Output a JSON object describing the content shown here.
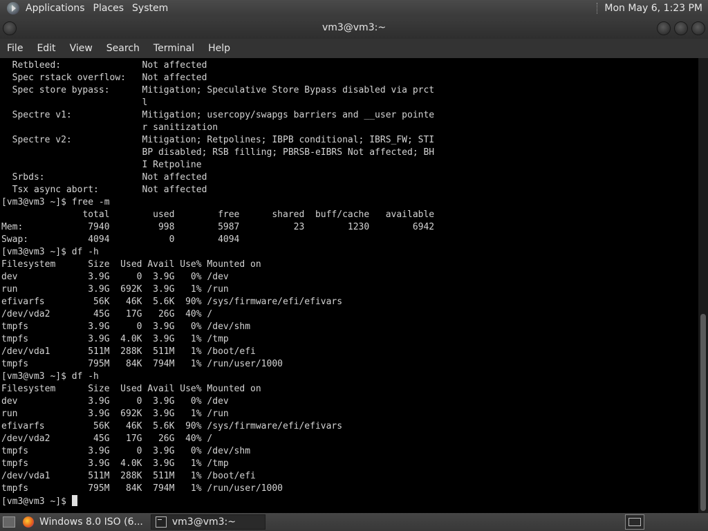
{
  "top_panel": {
    "menus": [
      "Applications",
      "Places",
      "System"
    ],
    "clock": "Mon May  6,  1:23 PM"
  },
  "window": {
    "title": "vm3@vm3:~"
  },
  "menubar": {
    "items": [
      "File",
      "Edit",
      "View",
      "Search",
      "Terminal",
      "Help"
    ]
  },
  "terminal": {
    "lines": [
      "  Retbleed:               Not affected",
      "  Spec rstack overflow:   Not affected",
      "  Spec store bypass:      Mitigation; Speculative Store Bypass disabled via prct",
      "                          l",
      "  Spectre v1:             Mitigation; usercopy/swapgs barriers and __user pointe",
      "                          r sanitization",
      "  Spectre v2:             Mitigation; Retpolines; IBPB conditional; IBRS_FW; STI",
      "                          BP disabled; RSB filling; PBRSB-eIBRS Not affected; BH",
      "                          I Retpoline",
      "  Srbds:                  Not affected",
      "  Tsx async abort:        Not affected",
      "[vm3@vm3 ~]$ free -m",
      "               total        used        free      shared  buff/cache   available",
      "Mem:            7940         998        5987          23        1230        6942",
      "Swap:           4094           0        4094",
      "[vm3@vm3 ~]$ df -h",
      "Filesystem      Size  Used Avail Use% Mounted on",
      "dev             3.9G     0  3.9G   0% /dev",
      "run             3.9G  692K  3.9G   1% /run",
      "efivarfs         56K   46K  5.6K  90% /sys/firmware/efi/efivars",
      "/dev/vda2        45G   17G   26G  40% /",
      "tmpfs           3.9G     0  3.9G   0% /dev/shm",
      "tmpfs           3.9G  4.0K  3.9G   1% /tmp",
      "/dev/vda1       511M  288K  511M   1% /boot/efi",
      "tmpfs           795M   84K  794M   1% /run/user/1000",
      "[vm3@vm3 ~]$ df -h",
      "Filesystem      Size  Used Avail Use% Mounted on",
      "dev             3.9G     0  3.9G   0% /dev",
      "run             3.9G  692K  3.9G   1% /run",
      "efivarfs         56K   46K  5.6K  90% /sys/firmware/efi/efivars",
      "/dev/vda2        45G   17G   26G  40% /",
      "tmpfs           3.9G     0  3.9G   0% /dev/shm",
      "tmpfs           3.9G  4.0K  3.9G   1% /tmp",
      "/dev/vda1       511M  288K  511M   1% /boot/efi",
      "tmpfs           795M   84K  794M   1% /run/user/1000"
    ],
    "prompt": "[vm3@vm3 ~]$ "
  },
  "taskbar": {
    "tasks": [
      {
        "label": "Windows 8.0 ISO (6...",
        "icon": "firefox-icon"
      },
      {
        "label": "vm3@vm3:~",
        "icon": "terminal-icon"
      }
    ]
  },
  "colors": {
    "terminal_bg": "#000000",
    "terminal_fg": "#d4d4d4",
    "panel_bg": "#3a3a3a"
  }
}
